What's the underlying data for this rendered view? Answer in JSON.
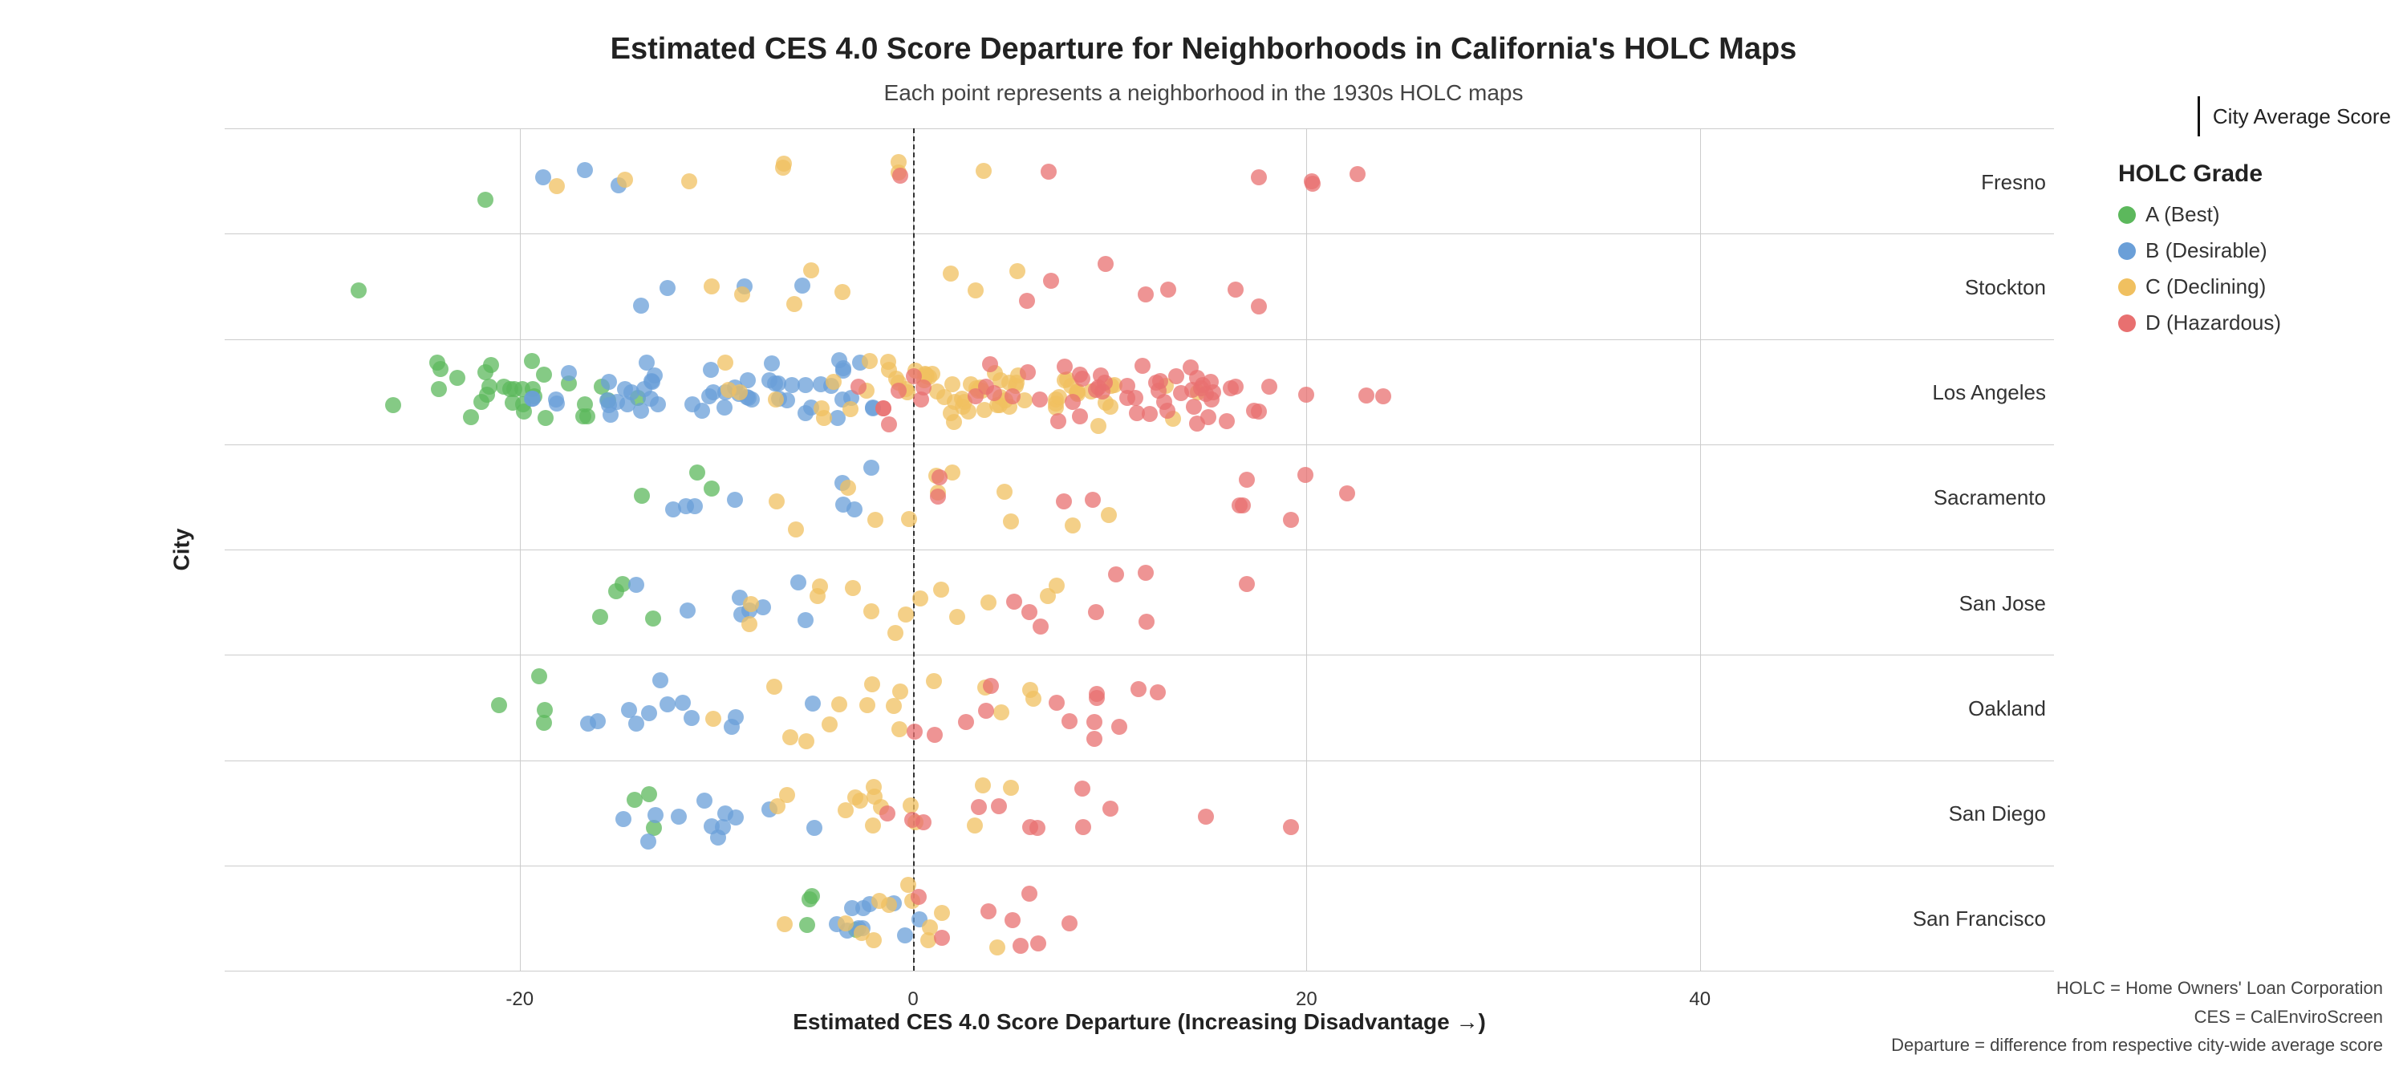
{
  "title": "Estimated CES 4.0 Score Departure for Neighborhoods in California's HOLC Maps",
  "subtitle": "Each point represents a neighborhood in the 1930s HOLC maps",
  "x_axis_label": "Estimated CES 4.0 Score Departure (Increasing Disadvantage →)",
  "y_axis_label": "City",
  "cities": [
    "Fresno",
    "Stockton",
    "Los Angeles",
    "Sacramento",
    "San Jose",
    "Oakland",
    "San Diego",
    "San Francisco"
  ],
  "legend_title": "HOLC Grade",
  "legend_items": [
    {
      "label": "A (Best)",
      "color": "#5cb85c"
    },
    {
      "label": "B (Desirable)",
      "color": "#6a9fd8"
    },
    {
      "label": "C (Declining)",
      "color": "#f0c060"
    },
    {
      "label": "D (Hazardous)",
      "color": "#e87070"
    }
  ],
  "city_avg_label": "City Average Score",
  "footnote_lines": [
    "HOLC = Home Owners' Loan Corporation",
    "CES = CalEnviroScreen",
    "Departure = difference from respective city-wide average score"
  ],
  "x_ticks": [
    -20,
    0,
    20,
    40
  ],
  "colors": {
    "A": "#5cb85c",
    "B": "#6a9fd8",
    "C": "#f0c060",
    "D": "#e87070"
  }
}
